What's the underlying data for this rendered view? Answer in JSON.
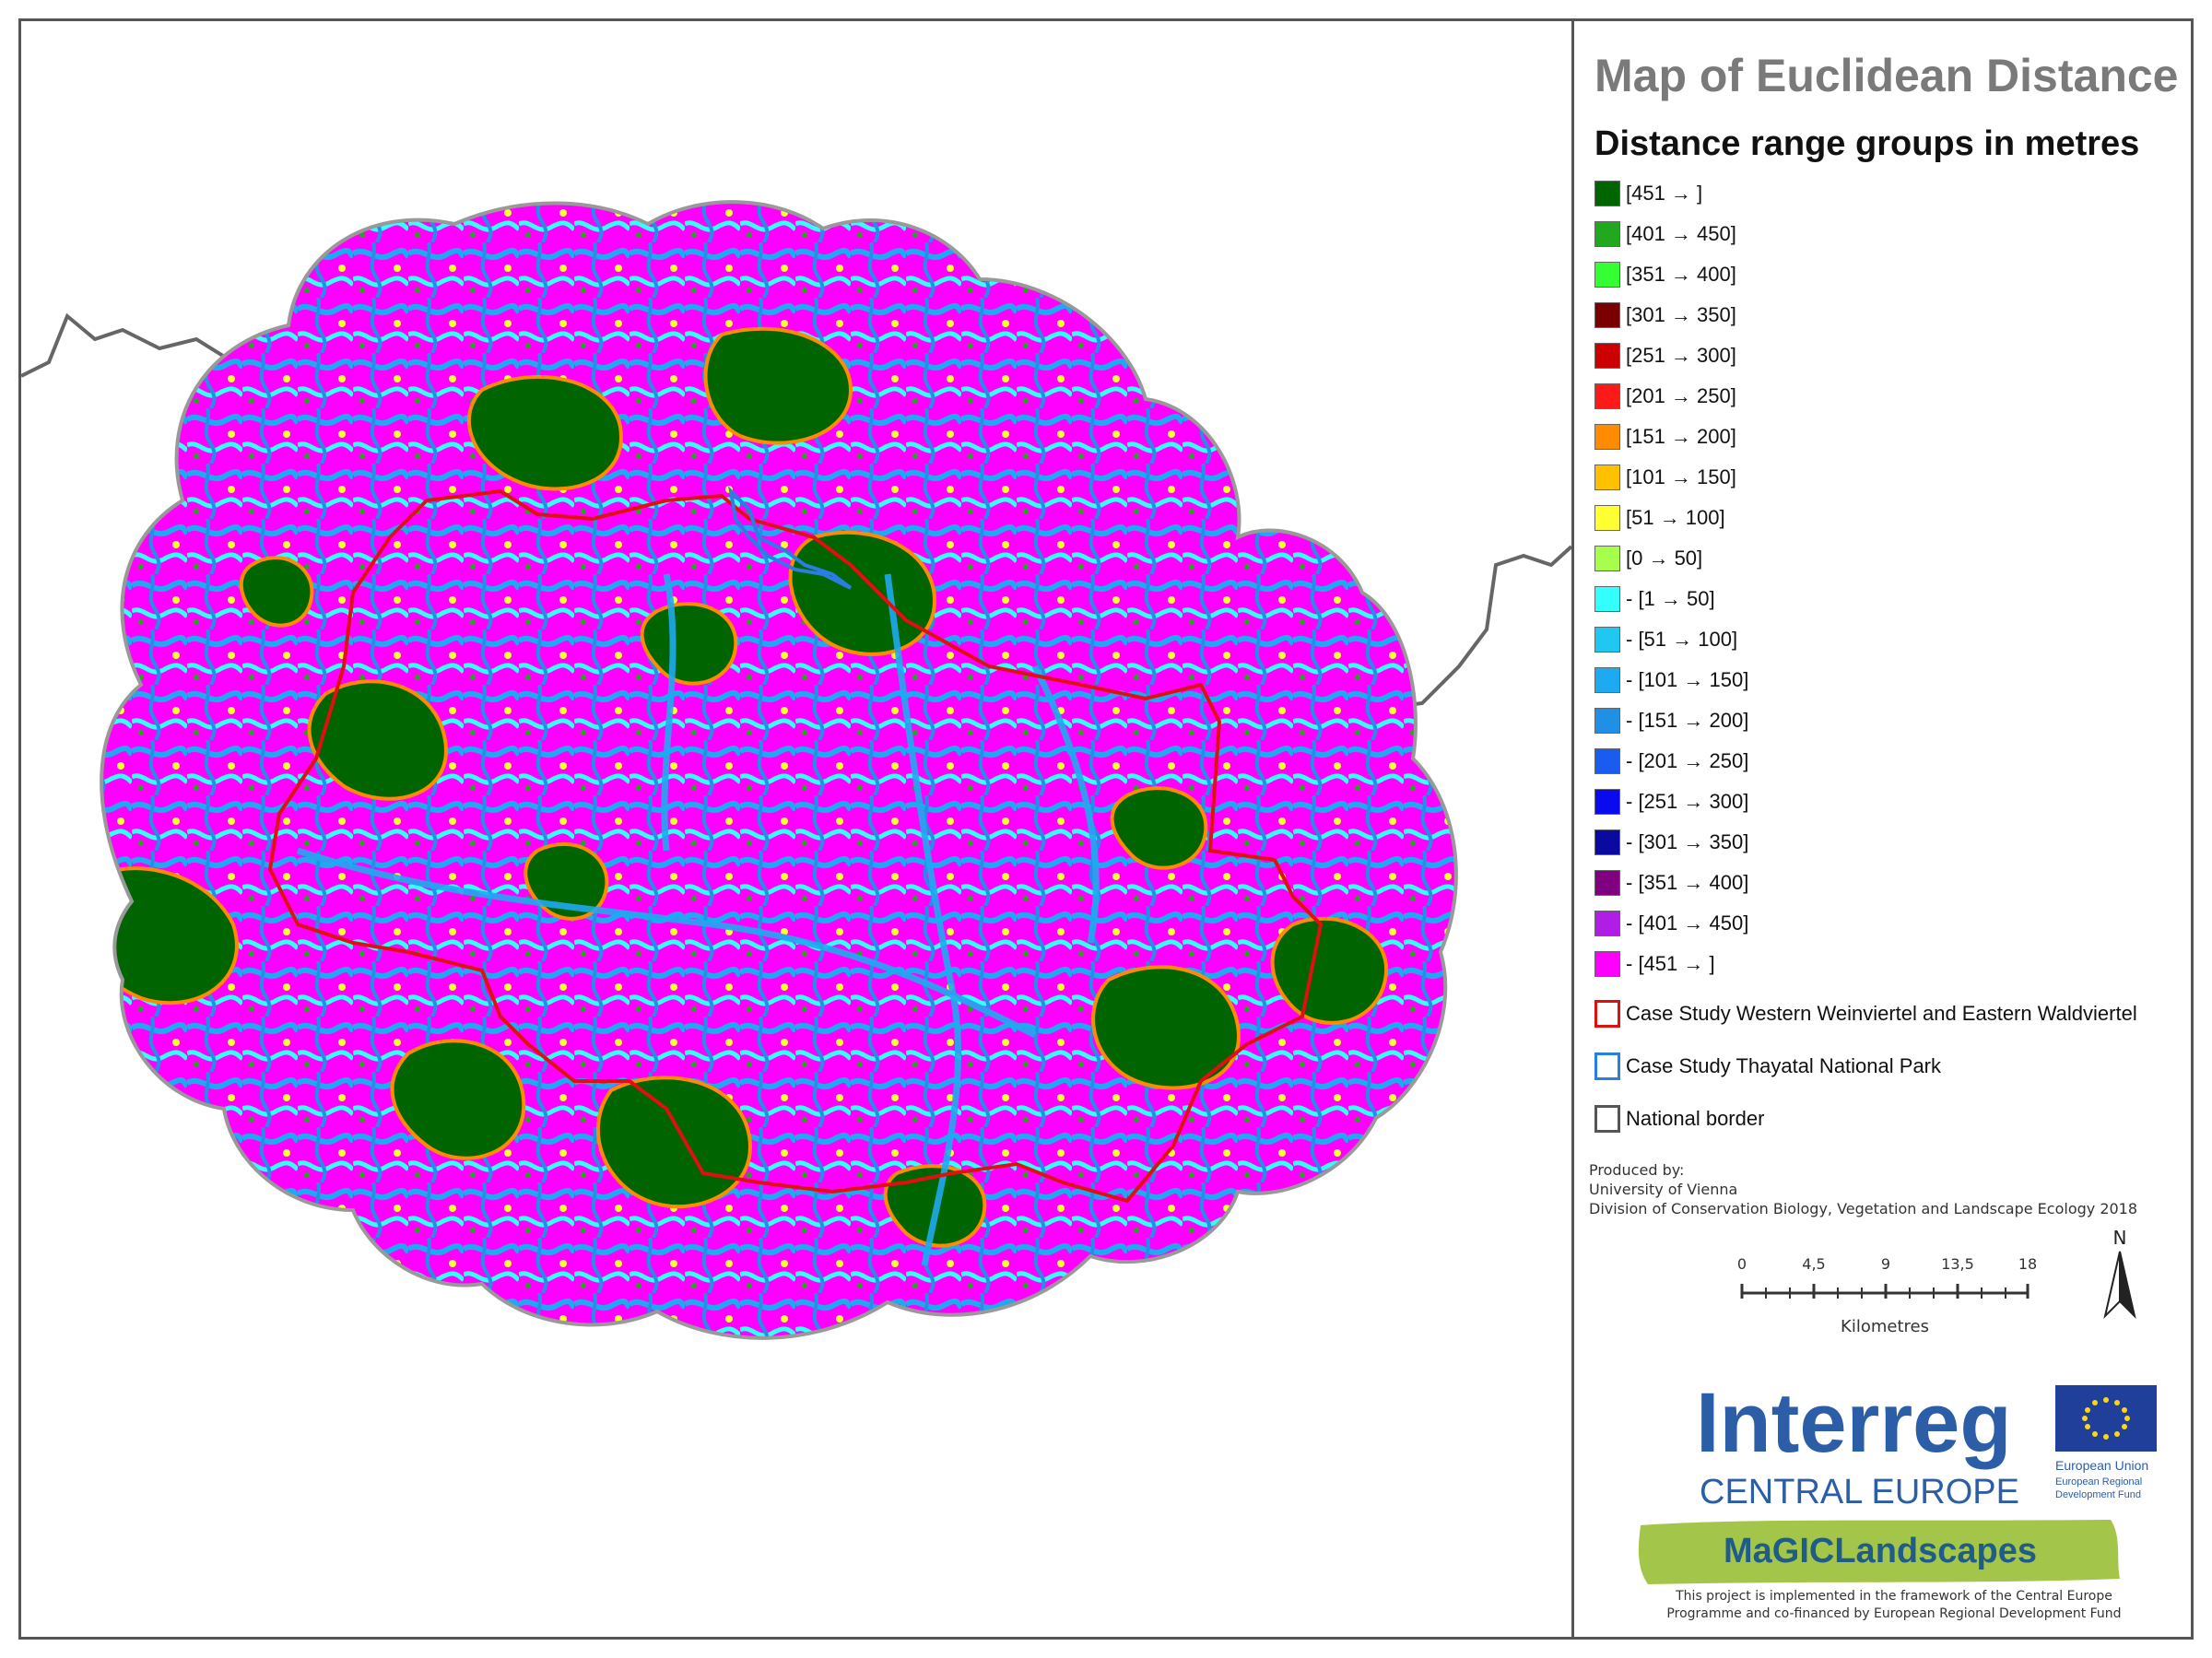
{
  "title": "Map of Euclidean Distance",
  "legend": {
    "heading": "Distance range groups in metres",
    "classes": [
      {
        "label": "[451 → ]",
        "color": "#006400"
      },
      {
        "label": "[401 → 450]",
        "color": "#22a81e"
      },
      {
        "label": "[351 → 400]",
        "color": "#33ff33"
      },
      {
        "label": "[301 → 350]",
        "color": "#7a0000"
      },
      {
        "label": "[251 → 300]",
        "color": "#cc0000"
      },
      {
        "label": "[201 → 250]",
        "color": "#ff1a1a"
      },
      {
        "label": "[151 → 200]",
        "color": "#ff8c00"
      },
      {
        "label": "[101 → 150]",
        "color": "#ffc000"
      },
      {
        "label": "[51 → 100]",
        "color": "#ffff33"
      },
      {
        "label": "[0 → 50]",
        "color": "#a6ff4d"
      },
      {
        "label": "- [1 → 50]",
        "color": "#33ffff"
      },
      {
        "label": "- [51 → 100]",
        "color": "#1ec8f0"
      },
      {
        "label": "- [101 → 150]",
        "color": "#1eaaf0"
      },
      {
        "label": "- [151 → 200]",
        "color": "#2090e6"
      },
      {
        "label": "- [201 → 250]",
        "color": "#1a5cf0"
      },
      {
        "label": "- [251 → 300]",
        "color": "#0a0aee"
      },
      {
        "label": "- [301 → 350]",
        "color": "#0a0aa0"
      },
      {
        "label": "- [351 → 400]",
        "color": "#800080"
      },
      {
        "label": "- [401 → 450]",
        "color": "#b01ee6"
      },
      {
        "label": "- [451 → ]",
        "color": "#ff00ff"
      }
    ],
    "outlines": [
      {
        "label": "Case Study Western Weinviertel and Eastern Waldviertel",
        "color": "#e01010"
      },
      {
        "label": "Case Study Thayatal National Park",
        "color": "#2a7de1"
      },
      {
        "label": "National border",
        "color": "#555555"
      }
    ]
  },
  "credit": {
    "line1": "Produced by:",
    "line2": "University of Vienna",
    "line3": "Division of Conservation Biology, Vegetation and Landscape Ecology 2018"
  },
  "scalebar": {
    "ticks": [
      "0",
      "4,5",
      "9",
      "13,5",
      "18"
    ],
    "unit": "Kilometres"
  },
  "north_label": "N",
  "logos": {
    "interreg_word": "Interreg",
    "interreg_sub": "CENTRAL EUROPE",
    "eu_line1": "European Union",
    "eu_line2": "European Regional",
    "eu_line3": "Development Fund",
    "project_name": "MaGICLandscapes"
  },
  "footer": {
    "line1": "This project is implemented in the framework of the Central Europe",
    "line2": "Programme and co-financed by European Regional Development Fund"
  }
}
